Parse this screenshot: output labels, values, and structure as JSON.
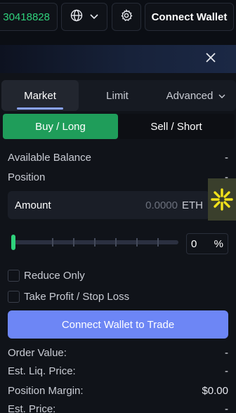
{
  "topbar": {
    "address": "30418828",
    "globe_icon": "globe-icon",
    "chevron_icon": "chevron-down-icon",
    "gear_icon": "gear-icon",
    "connect_label": "Connect Wallet"
  },
  "close_icon": "close-icon",
  "tabs": [
    {
      "label": "Market"
    },
    {
      "label": "Limit"
    },
    {
      "label": "Advanced"
    }
  ],
  "sides": {
    "buy": "Buy / Long",
    "sell": "Sell / Short"
  },
  "info": {
    "available_balance": {
      "label": "Available Balance",
      "value": "-"
    },
    "position": {
      "label": "Position",
      "value": "-"
    }
  },
  "amount": {
    "label": "Amount",
    "placeholder": "0.0000",
    "unit": "ETH"
  },
  "slider": {
    "value_percent": 0,
    "input": "0",
    "unit": "%"
  },
  "options": {
    "reduce_only": "Reduce Only",
    "tp_sl": "Take Profit / Stop Loss"
  },
  "cta_label": "Connect Wallet to Trade",
  "summary": [
    {
      "label": "Order Value:",
      "value": "-"
    },
    {
      "label": "Est. Liq. Price:",
      "value": "-"
    },
    {
      "label": "Position Margin:",
      "value": "$0.00"
    },
    {
      "label": "Est. Price:",
      "value": "-"
    }
  ],
  "colors": {
    "accent_green": "#1f9d5a",
    "cta_blue": "#6d86f5",
    "address_green": "#2fd27c"
  }
}
